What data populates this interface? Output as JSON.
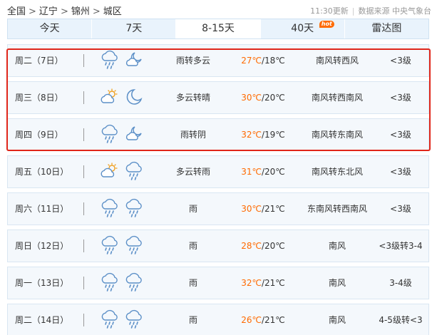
{
  "breadcrumb": {
    "items": [
      "全国",
      "辽宁",
      "锦州",
      "城区"
    ],
    "separator": ">"
  },
  "meta": {
    "updated": "11:30更新",
    "source": "数据来源 中央气象台"
  },
  "tabs": [
    {
      "label": "今天",
      "active": false
    },
    {
      "label": "7天",
      "active": false
    },
    {
      "label": "8-15天",
      "active": true
    },
    {
      "label": "40天",
      "active": false,
      "badge": "hot"
    },
    {
      "label": "雷达图",
      "active": false
    }
  ],
  "forecast": [
    {
      "day": "周二（7日）",
      "icons": [
        "rain-cloud-icon",
        "cloudy-night-icon"
      ],
      "desc": "雨转多云",
      "high": "27℃",
      "low": "/18℃",
      "wind": "南风转西风",
      "level": "<3级"
    },
    {
      "day": "周三（8日）",
      "icons": [
        "partly-cloudy-icon",
        "moon-icon"
      ],
      "desc": "多云转晴",
      "high": "30℃",
      "low": "/20℃",
      "wind": "南风转西南风",
      "level": "<3级"
    },
    {
      "day": "周四（9日）",
      "icons": [
        "rain-cloud-icon",
        "cloudy-night-icon"
      ],
      "desc": "雨转阴",
      "high": "32℃",
      "low": "/19℃",
      "wind": "南风转东南风",
      "level": "<3级"
    },
    {
      "day": "周五（10日）",
      "icons": [
        "partly-cloudy-icon",
        "rain-cloud-icon"
      ],
      "desc": "多云转雨",
      "high": "31℃",
      "low": "/20℃",
      "wind": "南风转东北风",
      "level": "<3级"
    },
    {
      "day": "周六（11日）",
      "icons": [
        "rain-cloud-icon",
        "rain-cloud-icon"
      ],
      "desc": "雨",
      "high": "30℃",
      "low": "/21℃",
      "wind": "东南风转西南风",
      "level": "<3级"
    },
    {
      "day": "周日（12日）",
      "icons": [
        "rain-cloud-icon",
        "rain-cloud-icon"
      ],
      "desc": "雨",
      "high": "28℃",
      "low": "/20℃",
      "wind": "南风",
      "level": "<3级转3-4"
    },
    {
      "day": "周一（13日）",
      "icons": [
        "rain-cloud-icon",
        "rain-cloud-icon"
      ],
      "desc": "雨",
      "high": "32℃",
      "low": "/21℃",
      "wind": "南风",
      "level": "3-4级"
    },
    {
      "day": "周二（14日）",
      "icons": [
        "rain-cloud-icon",
        "rain-cloud-icon"
      ],
      "desc": "雨",
      "high": "26℃",
      "low": "/21℃",
      "wind": "南风",
      "level": "4-5级转<3"
    }
  ],
  "colors": {
    "accent_orange": "#ff6a00",
    "tab_bg": "#e9f3fc",
    "row_bg": "#f4f8fc",
    "highlight_red": "#e0261a",
    "icon_blue": "#5b8fc7"
  }
}
